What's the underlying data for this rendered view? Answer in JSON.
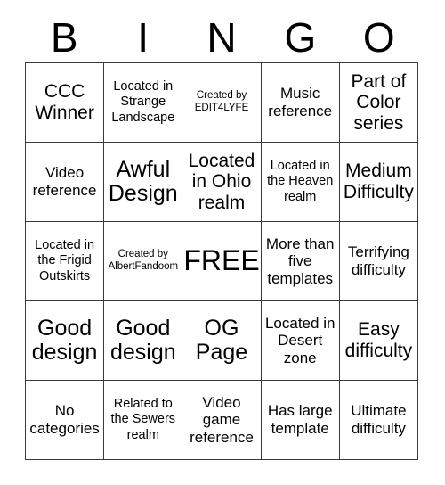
{
  "header": {
    "letters": [
      "B",
      "I",
      "N",
      "G",
      "O"
    ]
  },
  "grid": {
    "rows": 5,
    "columns": 5,
    "border_color": "#3a3a3a",
    "background_color": "#ffffff",
    "text_color": "#000000",
    "cells": [
      {
        "text": "CCC Winner",
        "size": "lg",
        "free": false
      },
      {
        "text": "Located in Strange Landscape",
        "size": "sm",
        "free": false
      },
      {
        "text": "Created by EDIT4LYFE",
        "size": "xs",
        "free": false
      },
      {
        "text": "Music reference",
        "size": "md",
        "free": false
      },
      {
        "text": "Part of Color series",
        "size": "lg",
        "free": false
      },
      {
        "text": "Video reference",
        "size": "md",
        "free": false
      },
      {
        "text": "Awful Design",
        "size": "xl",
        "free": false
      },
      {
        "text": "Located in Ohio realm",
        "size": "lg",
        "free": false
      },
      {
        "text": "Located in the Heaven realm",
        "size": "sm",
        "free": false
      },
      {
        "text": "Medium Difficulty",
        "size": "lg",
        "free": false
      },
      {
        "text": "Located in the Frigid Outskirts",
        "size": "sm",
        "free": false
      },
      {
        "text": "Created by AlbertFandoom",
        "size": "xs",
        "free": false
      },
      {
        "text": "FREE",
        "size": "free",
        "free": true
      },
      {
        "text": "More than five templates",
        "size": "md",
        "free": false
      },
      {
        "text": "Terrifying difficulty",
        "size": "md",
        "free": false
      },
      {
        "text": "Good design",
        "size": "xl",
        "free": false
      },
      {
        "text": "Good design",
        "size": "xl",
        "free": false
      },
      {
        "text": "OG Page",
        "size": "xl",
        "free": false
      },
      {
        "text": "Located in Desert zone",
        "size": "md",
        "free": false
      },
      {
        "text": "Easy difficulty",
        "size": "lg",
        "free": false
      },
      {
        "text": "No categories",
        "size": "md",
        "free": false
      },
      {
        "text": "Related to the Sewers realm",
        "size": "sm",
        "free": false
      },
      {
        "text": "Video game reference",
        "size": "md",
        "free": false
      },
      {
        "text": "Has large template",
        "size": "md",
        "free": false
      },
      {
        "text": "Ultimate difficulty",
        "size": "md",
        "free": false
      }
    ]
  }
}
